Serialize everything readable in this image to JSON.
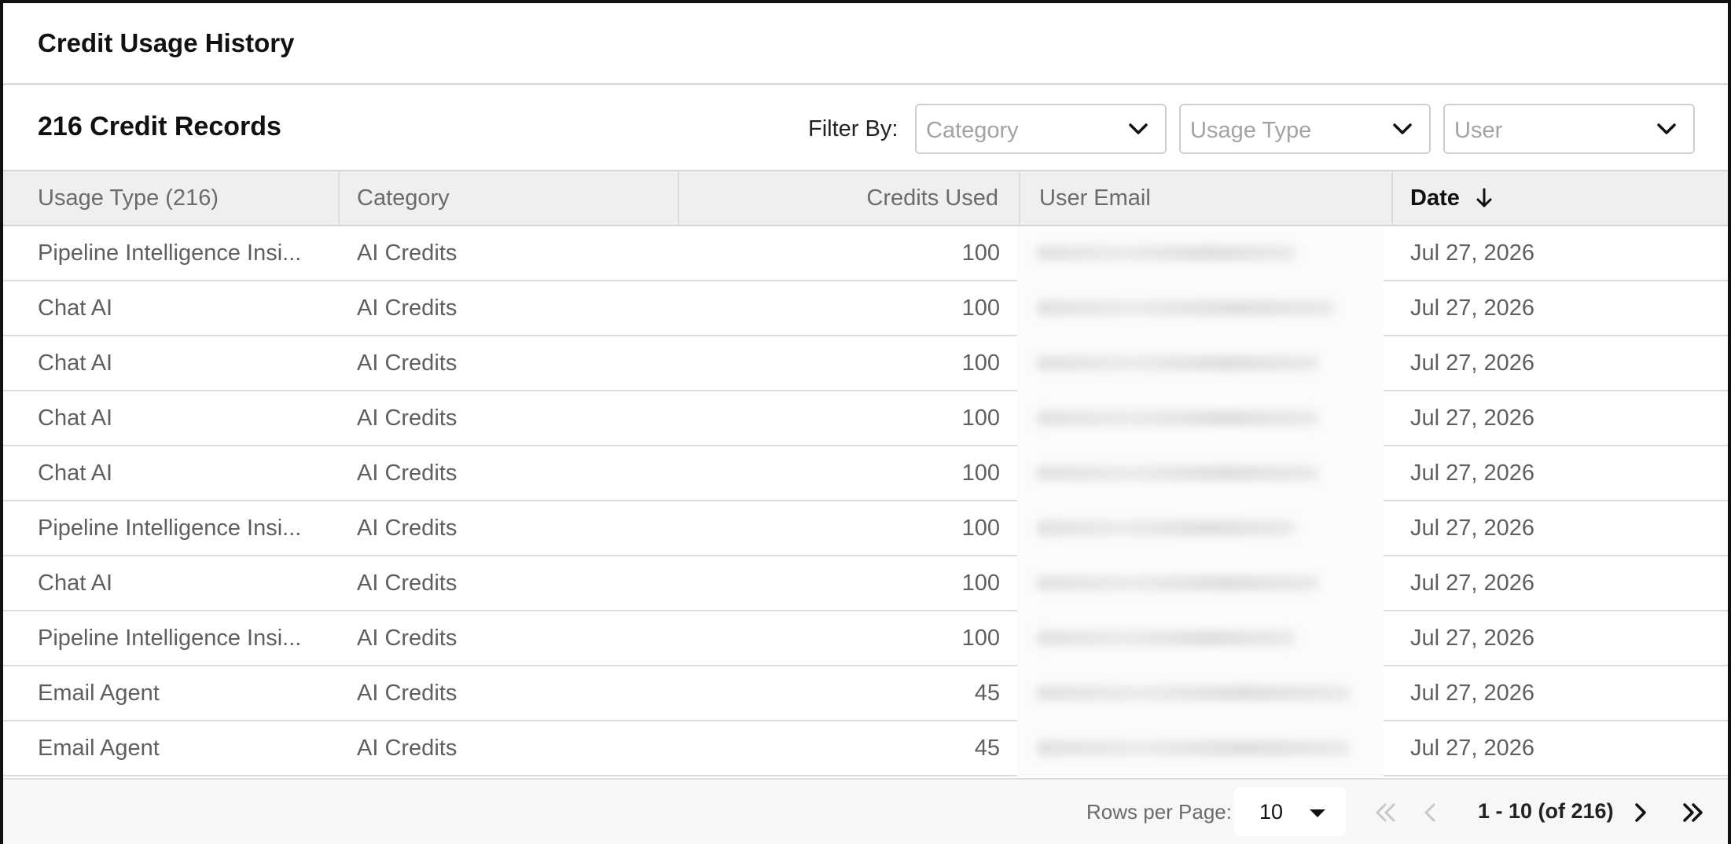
{
  "title": "Credit Usage History",
  "toolbar": {
    "record_count": "216 Credit Records",
    "filter_label": "Filter By:",
    "filters": [
      {
        "placeholder": "Category"
      },
      {
        "placeholder": "Usage Type"
      },
      {
        "placeholder": "User"
      }
    ]
  },
  "table": {
    "columns": [
      "Usage Type (216)",
      "Category",
      "Credits Used",
      "User Email",
      "Date"
    ],
    "sorted_column": "Date",
    "sort_direction": "descending",
    "rows": [
      {
        "usage_type": "Pipeline Intelligence Insi...",
        "category": "AI Credits",
        "credits": "100",
        "date": "Jul 27, 2026"
      },
      {
        "usage_type": "Chat AI",
        "category": "AI Credits",
        "credits": "100",
        "date": "Jul 27, 2026"
      },
      {
        "usage_type": "Chat AI",
        "category": "AI Credits",
        "credits": "100",
        "date": "Jul 27, 2026"
      },
      {
        "usage_type": "Chat AI",
        "category": "AI Credits",
        "credits": "100",
        "date": "Jul 27, 2026"
      },
      {
        "usage_type": "Chat AI",
        "category": "AI Credits",
        "credits": "100",
        "date": "Jul 27, 2026"
      },
      {
        "usage_type": "Pipeline Intelligence Insi...",
        "category": "AI Credits",
        "credits": "100",
        "date": "Jul 27, 2026"
      },
      {
        "usage_type": "Chat AI",
        "category": "AI Credits",
        "credits": "100",
        "date": "Jul 27, 2026"
      },
      {
        "usage_type": "Pipeline Intelligence Insi...",
        "category": "AI Credits",
        "credits": "100",
        "date": "Jul 27, 2026"
      },
      {
        "usage_type": "Email Agent",
        "category": "AI Credits",
        "credits": "45",
        "date": "Jul 27, 2026"
      },
      {
        "usage_type": "Email Agent",
        "category": "AI Credits",
        "credits": "45",
        "date": "Jul 27, 2026"
      }
    ]
  },
  "pagination": {
    "rows_per_page_label": "Rows per Page:",
    "rows_per_page": "10",
    "range": "1 - 10 (of 216)"
  },
  "icons": {
    "filter_chevron": "chevron-down-icon",
    "sort": "arrow-down-icon",
    "first": "double-chevron-left-icon",
    "prev": "chevron-left-icon",
    "next": "chevron-right-icon",
    "last": "double-chevron-right-icon"
  },
  "colors": {
    "header_bg": "#efefef",
    "border": "#dcdcdc",
    "text_primary": "#111111",
    "text_muted": "#5f5f5f",
    "placeholder": "#a3a3a3",
    "disabled_icon": "#c8c8c8"
  }
}
